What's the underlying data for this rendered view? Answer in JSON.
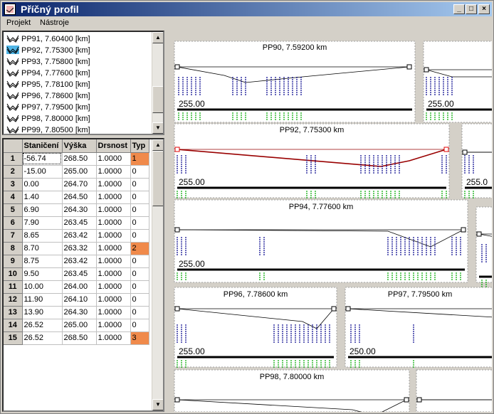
{
  "window": {
    "title": "Příčný profil",
    "minimize_label": "_",
    "maximize_label": "□",
    "close_label": "×"
  },
  "menu": {
    "items": [
      "Projekt",
      "Nástroje"
    ]
  },
  "profile_list": {
    "items": [
      {
        "label": "PP91, 7.60400 [km]",
        "selected": false
      },
      {
        "label": "PP92, 7.75300 [km]",
        "selected": true
      },
      {
        "label": "PP93, 7.75800 [km]",
        "selected": false
      },
      {
        "label": "PP94, 7.77600 [km]",
        "selected": false
      },
      {
        "label": "PP95, 7.78100 [km]",
        "selected": false
      },
      {
        "label": "PP96, 7.78600 [km]",
        "selected": false
      },
      {
        "label": "PP97, 7.79500 [km]",
        "selected": false
      },
      {
        "label": "PP98, 7.80000 [km]",
        "selected": false
      },
      {
        "label": "PP99, 7.80500 [km]",
        "selected": false
      }
    ]
  },
  "grid": {
    "headers": [
      "Staničení",
      "Výška",
      "Drsnost",
      "Typ"
    ],
    "rows": [
      {
        "n": "1",
        "st": "-56.74",
        "v": "268.50",
        "d": "1.0000",
        "t": "1",
        "hl": true
      },
      {
        "n": "2",
        "st": "-15.00",
        "v": "265.00",
        "d": "1.0000",
        "t": "0",
        "hl": false
      },
      {
        "n": "3",
        "st": "0.00",
        "v": "264.70",
        "d": "1.0000",
        "t": "0",
        "hl": false
      },
      {
        "n": "4",
        "st": "1.40",
        "v": "264.50",
        "d": "1.0000",
        "t": "0",
        "hl": false
      },
      {
        "n": "5",
        "st": "6.90",
        "v": "264.30",
        "d": "1.0000",
        "t": "0",
        "hl": false
      },
      {
        "n": "6",
        "st": "7.90",
        "v": "263.45",
        "d": "1.0000",
        "t": "0",
        "hl": false
      },
      {
        "n": "7",
        "st": "8.65",
        "v": "263.42",
        "d": "1.0000",
        "t": "0",
        "hl": false
      },
      {
        "n": "8",
        "st": "8.70",
        "v": "263.32",
        "d": "1.0000",
        "t": "2",
        "hl": true
      },
      {
        "n": "9",
        "st": "8.75",
        "v": "263.42",
        "d": "1.0000",
        "t": "0",
        "hl": false
      },
      {
        "n": "10",
        "st": "9.50",
        "v": "263.45",
        "d": "1.0000",
        "t": "0",
        "hl": false
      },
      {
        "n": "11",
        "st": "10.00",
        "v": "264.00",
        "d": "1.0000",
        "t": "0",
        "hl": false
      },
      {
        "n": "12",
        "st": "11.90",
        "v": "264.10",
        "d": "1.0000",
        "t": "0",
        "hl": false
      },
      {
        "n": "13",
        "st": "13.90",
        "v": "264.30",
        "d": "1.0000",
        "t": "0",
        "hl": false
      },
      {
        "n": "14",
        "st": "26.52",
        "v": "265.00",
        "d": "1.0000",
        "t": "0",
        "hl": false
      },
      {
        "n": "15",
        "st": "26.52",
        "v": "268.50",
        "d": "1.0000",
        "t": "3",
        "hl": true
      }
    ]
  },
  "profiles": [
    {
      "title": "PP90, 7.59200 km",
      "base": "255.00"
    },
    {
      "title": "",
      "base": "255.00"
    },
    {
      "title": "PP92, 7.75300 km",
      "base": "255.00"
    },
    {
      "title": "",
      "base": "255.0"
    },
    {
      "title": "PP94, 7.77600 km",
      "base": "255.00"
    },
    {
      "title": "PP96, 7.78600 km",
      "base": "255.00"
    },
    {
      "title": "PP97, 7.79500 km",
      "base": "250.00"
    },
    {
      "title": "PP98, 7.80000 km",
      "base": ""
    }
  ],
  "colors": {
    "selected_profile": "#990000",
    "height_labels": "#00008b",
    "station_labels": "#00aa00",
    "typ_highlight": "#f08a4b"
  }
}
